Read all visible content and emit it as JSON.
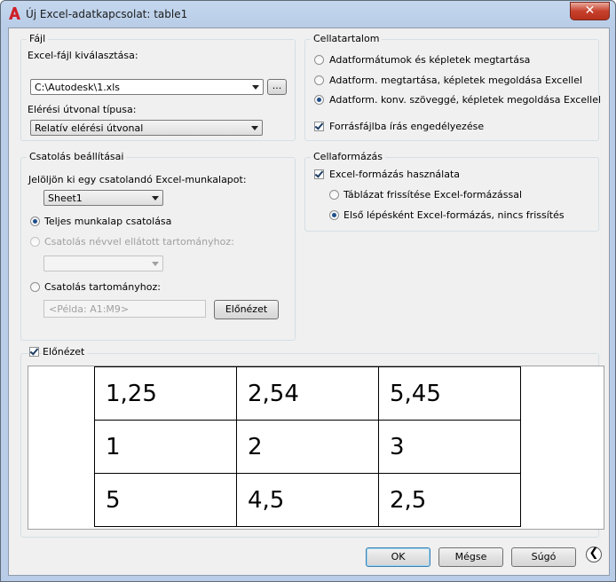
{
  "window": {
    "title": "Új Excel-adatkapcsolat: table1",
    "close_glyph": "✕"
  },
  "file_group": {
    "title": "Fájl",
    "choose_label": "Excel-fájl kiválasztása:",
    "file_value": "C:\\Autodesk\\1.xls",
    "browse_label": "...",
    "path_type_label": "Elérési útvonal típusa:",
    "path_type_value": "Relatív elérési útvonal"
  },
  "link_group": {
    "title": "Csatolás beállításai",
    "select_sheet_label": "Jelöljön ki egy csatolandó Excel-munkalapot:",
    "sheet_value": "Sheet1",
    "opt_full_sheet": "Teljes munkalap csatolása",
    "opt_named_range": "Csatolás névvel ellátott tartományhoz:",
    "opt_range": "Csatolás tartományhoz:",
    "range_placeholder": "<Példa: A1:M9>",
    "preview_button": "Előnézet"
  },
  "content_group": {
    "title": "Cellatartalom",
    "opt1": "Adatformátumok és képletek megtartása",
    "opt2": "Adatform. megtartása, képletek megoldása Excellel",
    "opt3": "Adatform. konv. szöveggé, képletek megoldása Excellel",
    "allow_write": "Forrásfájlba írás engedélyezése"
  },
  "format_group": {
    "title": "Cellaformázás",
    "use_excel": "Excel-formázás használata",
    "opt_update": "Táblázat frissítése Excel-formázással",
    "opt_first": "Első lépésként Excel-formázás, nincs frissítés"
  },
  "preview": {
    "label": "Előnézet",
    "rows": [
      [
        "1,25",
        "2,54",
        "5,45"
      ],
      [
        "1",
        "2",
        "3"
      ],
      [
        "5",
        "4,5",
        "2,5"
      ]
    ]
  },
  "buttons": {
    "ok": "OK",
    "cancel": "Mégse",
    "help": "Súgó",
    "back_glyph": "❮"
  },
  "colors": {
    "titlebar": "#b9cde8",
    "close": "#c7402c",
    "app_icon": "#d0202a"
  }
}
